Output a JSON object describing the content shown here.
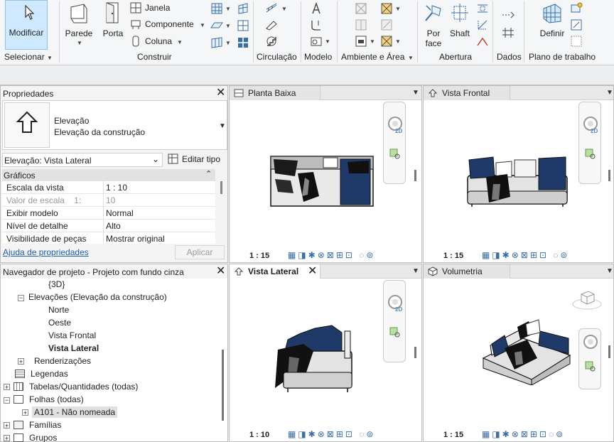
{
  "ribbon": {
    "modify": "Modificar",
    "wall": "Parede",
    "door": "Porta",
    "window": "Janela",
    "component": "Componente",
    "column": "Coluna",
    "by_face": "Por face",
    "shaft": "Shaft",
    "set": "Definir",
    "select_panel": "Selecionar",
    "panels": [
      "Construir",
      "Circulação",
      "Modelo",
      "Ambiente e Área",
      "Abertura",
      "Dados",
      "Plano de trabalho"
    ]
  },
  "properties": {
    "title": "Propriedades",
    "type_name": "Elevação",
    "type_sub": "Elevação da construção",
    "selector": "Elevação: Vista Lateral",
    "edit_type": "Editar tipo",
    "group": "Gráficos",
    "rows": [
      {
        "name": "Escala da vista",
        "value": "1 : 10"
      },
      {
        "name": "Valor de escala    1:",
        "value": "10"
      },
      {
        "name": "Exibir modelo",
        "value": "Normal"
      },
      {
        "name": "Nível de detalhe",
        "value": "Alto"
      },
      {
        "name": "Visibilidade de peças",
        "value": "Mostrar original"
      }
    ],
    "help_link": "Ajuda de propriedades",
    "apply": "Aplicar"
  },
  "browser": {
    "title": "Navegador de projeto - Projeto com fundo cinza",
    "items": [
      "{3D}",
      "Elevações (Elevação da construção)",
      "Norte",
      "Oeste",
      "Vista Frontal",
      "Vista Lateral",
      "Renderizações",
      "Legendas",
      "Tabelas/Quantidades (todas)",
      "Folhas (todas)",
      "A101 - Não nomeada",
      "Famílias",
      "Grupos"
    ]
  },
  "views": {
    "plan": {
      "title": "Planta Baixa",
      "scale": "1 : 15"
    },
    "front": {
      "title": "Vista Frontal",
      "scale": "1 : 15"
    },
    "side": {
      "title": "Vista Lateral",
      "scale": "1 : 10"
    },
    "volume": {
      "title": "Volumetria",
      "scale": "1 : 15"
    }
  },
  "navbar_label": "2D",
  "colors": {
    "accent": "#cde8ff",
    "blue_cushion": "#1f3a68",
    "link": "#1a5fb4"
  }
}
